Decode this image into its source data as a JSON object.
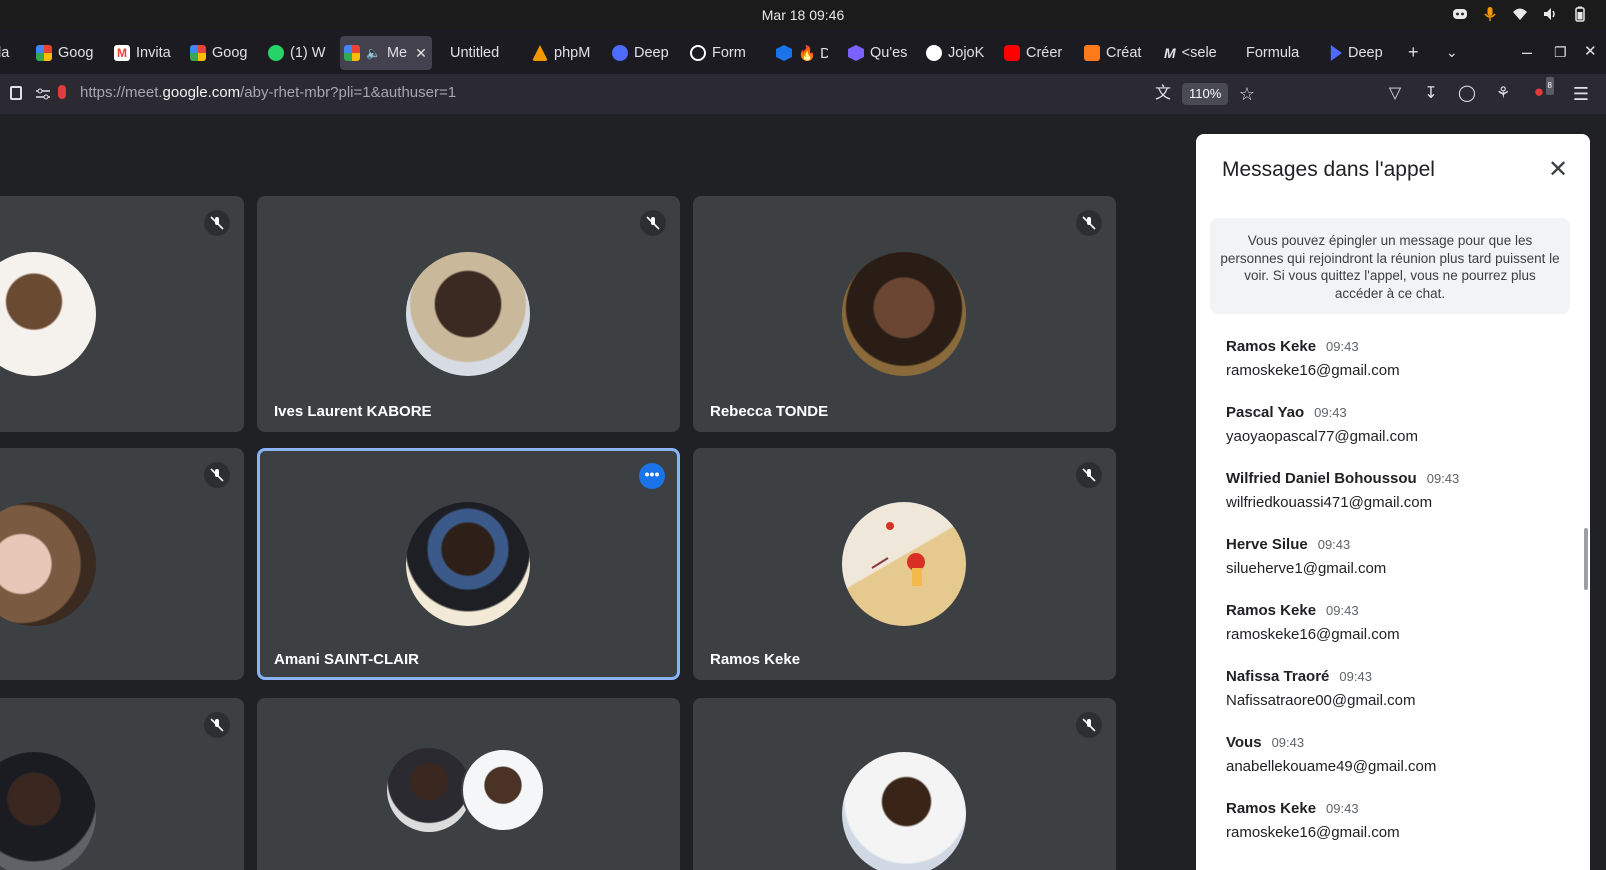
{
  "system": {
    "clock": "Mar 18  09:46"
  },
  "tabs": [
    {
      "label": "la",
      "color": "#f29900"
    },
    {
      "label": "Goog",
      "color": "#34a853"
    },
    {
      "label": "Invita",
      "color": "#ea4335"
    },
    {
      "label": "Goog",
      "color": "#34a853"
    },
    {
      "label": "(1) W",
      "color": "#25d366"
    },
    {
      "label": "Me",
      "color": "#34a853"
    },
    {
      "label": "Untitled",
      "color": ""
    },
    {
      "label": "phpM",
      "color": "#f29900"
    },
    {
      "label": "Deep",
      "color": "#4d6bfe"
    },
    {
      "label": "Form",
      "color": "#ffffff"
    },
    {
      "label": "🔥 D",
      "color": "#1a73e8"
    },
    {
      "label": "Qu'es",
      "color": "#7b61ff"
    },
    {
      "label": "JojoK",
      "color": "#ffffff"
    },
    {
      "label": "Créer",
      "color": "#ff0000"
    },
    {
      "label": "Créat",
      "color": "#ff7a1a"
    },
    {
      "label": "<sele",
      "color": "#ffffff"
    },
    {
      "label": "Formula",
      "color": ""
    },
    {
      "label": "Deep",
      "color": "#4d6bfe"
    }
  ],
  "urlbar": {
    "scheme": "https://meet.",
    "domain": "google.com",
    "path": "/aby-rhet-mbr?pli=1&authuser=1",
    "zoom": "110%",
    "extension_badge": "8"
  },
  "participants": [
    {
      "name": "",
      "muted": true
    },
    {
      "name": "Ives Laurent KABORE",
      "muted": true
    },
    {
      "name": "Rebecca TONDE",
      "muted": true
    },
    {
      "name": "",
      "muted": true
    },
    {
      "name": "Amani SAINT-CLAIR",
      "muted": false
    },
    {
      "name": "Ramos Keke",
      "muted": true
    },
    {
      "name": "",
      "muted": true
    },
    {
      "name": "",
      "muted": false
    },
    {
      "name": "",
      "muted": true
    }
  ],
  "chat": {
    "title": "Messages dans l'appel",
    "notice": "Vous pouvez épingler un message pour que les personnes qui rejoindront la réunion plus tard puissent le voir. Si vous quittez l'appel, vous ne pourrez plus accéder à ce chat.",
    "messages": [
      {
        "sender": "Ramos Keke",
        "time": "09:43",
        "text": "ramoskeke16@gmail.com"
      },
      {
        "sender": "Pascal Yao",
        "time": "09:43",
        "text": "yaoyaopascal77@gmail.com"
      },
      {
        "sender": "Wilfried Daniel Bohoussou",
        "time": "09:43",
        "text": "wilfriedkouassi471@gmail.com"
      },
      {
        "sender": "Herve Silue",
        "time": "09:43",
        "text": "silueherve1@gmail.com"
      },
      {
        "sender": "Ramos Keke",
        "time": "09:43",
        "text": "ramoskeke16@gmail.com"
      },
      {
        "sender": "Nafissa Traoré",
        "time": "09:43",
        "text": "Nafissatraore00@gmail.com"
      },
      {
        "sender": "Vous",
        "time": "09:43",
        "text": "anabellekouame49@gmail.com"
      },
      {
        "sender": "Ramos Keke",
        "time": "09:43",
        "text": "ramoskeke16@gmail.com"
      }
    ]
  },
  "colors": {
    "tile": "#3c4043",
    "selected_border": "#8ab4f8",
    "accent": "#1a73e8"
  }
}
